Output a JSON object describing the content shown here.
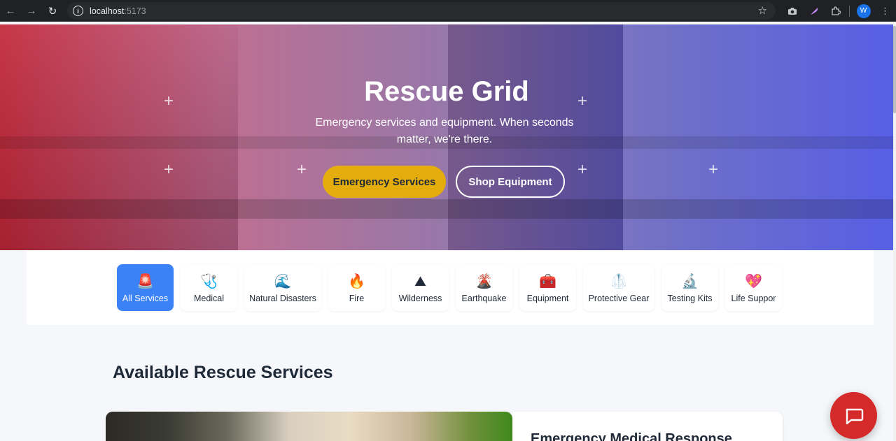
{
  "browser": {
    "url_host": "localhost",
    "url_port": ":5173",
    "profile_initial": "W"
  },
  "hero": {
    "title": "Rescue Grid",
    "subtitle": "Emergency services and equipment. When seconds matter, we're there.",
    "primary_button": "Emergency Services",
    "secondary_button": "Shop Equipment"
  },
  "categories": [
    {
      "label": "All Services",
      "icon": "siren-icon",
      "active": true
    },
    {
      "label": "Medical",
      "icon": "stethoscope-icon",
      "active": false
    },
    {
      "label": "Natural Disasters",
      "icon": "wave-icon",
      "active": false
    },
    {
      "label": "Fire",
      "icon": "fire-icon",
      "active": false
    },
    {
      "label": "Wilderness",
      "icon": "mountain-icon",
      "active": false
    },
    {
      "label": "Earthquake",
      "icon": "volcano-icon",
      "active": false
    },
    {
      "label": "Equipment",
      "icon": "toolbox-icon",
      "active": false
    },
    {
      "label": "Protective Gear",
      "icon": "lab-coat-icon",
      "active": false
    },
    {
      "label": "Testing Kits",
      "icon": "microscope-icon",
      "active": false
    },
    {
      "label": "Life Suppor",
      "icon": "heart-icon",
      "active": false
    }
  ],
  "section": {
    "title": "Available Rescue Services"
  },
  "service_card": {
    "title": "Emergency Medical Response"
  },
  "colors": {
    "accent_blue": "#3b82f6",
    "primary_yellow": "#e5ad0b",
    "chat_red": "#d42a2a"
  }
}
